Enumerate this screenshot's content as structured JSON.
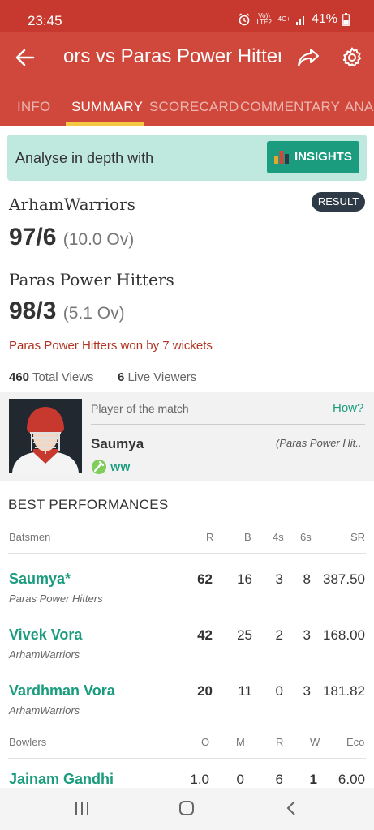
{
  "status": {
    "time": "23:45",
    "network_top": "Vo)) LTE2",
    "network_4g": "4G+",
    "battery": "41%"
  },
  "toolbar": {
    "title": "ors vs Paras Power Hitter",
    "back_icon": "arrow-left-icon",
    "share_icon": "share-icon",
    "settings_icon": "gear-icon"
  },
  "tabs": [
    {
      "label": "INFO",
      "active": false
    },
    {
      "label": "SUMMARY",
      "active": true
    },
    {
      "label": "SCORECARD",
      "active": false
    },
    {
      "label": "COMMENTARY",
      "active": false
    },
    {
      "label": "ANA",
      "active": false
    }
  ],
  "insights": {
    "text": "Analyse in depth with",
    "button": "INSIGHTS"
  },
  "match": {
    "team1": {
      "name": "ArhamWarriors",
      "score": "97/6",
      "overs": "(10.0 Ov)"
    },
    "team2": {
      "name": "Paras Power Hitters",
      "score": "98/3",
      "overs": "(5.1 Ov)"
    },
    "badge": "RESULT",
    "result": "Paras Power Hitters won by 7 wickets",
    "total_views": "460",
    "total_views_label": "Total Views",
    "live_viewers": "6",
    "live_viewers_label": "Live Viewers"
  },
  "potm": {
    "label": "Player of the match",
    "how": "How?",
    "name": "Saumya",
    "team": "(Paras Power Hit..",
    "role": "WW"
  },
  "best": {
    "title": "BEST PERFORMANCES",
    "bat_headers": [
      "Batsmen",
      "R",
      "B",
      "4s",
      "6s",
      "SR"
    ],
    "batsmen": [
      {
        "name": "Saumya*",
        "team": "Paras Power Hitters",
        "r": "62",
        "b": "16",
        "fours": "3",
        "sixes": "8",
        "sr": "387.50"
      },
      {
        "name": "Vivek Vora",
        "team": "ArhamWarriors",
        "r": "42",
        "b": "25",
        "fours": "2",
        "sixes": "3",
        "sr": "168.00"
      },
      {
        "name": "Vardhman Vora",
        "team": "ArhamWarriors",
        "r": "20",
        "b": "11",
        "fours": "0",
        "sixes": "3",
        "sr": "181.82"
      }
    ],
    "bowl_headers": [
      "Bowlers",
      "O",
      "M",
      "R",
      "W",
      "Eco"
    ],
    "bowlers": [
      {
        "name": "Jainam Gandhi",
        "o": "1.0",
        "m": "0",
        "r": "6",
        "w": "1",
        "eco": "6.00"
      }
    ]
  },
  "nav": {
    "recent_icon": "recent-apps-icon",
    "home_icon": "home-icon",
    "back_icon": "back-nav-icon"
  },
  "colors": {
    "header": "#d0483b",
    "accent": "#1b9c7e",
    "tab_indicator": "#f5c842"
  }
}
